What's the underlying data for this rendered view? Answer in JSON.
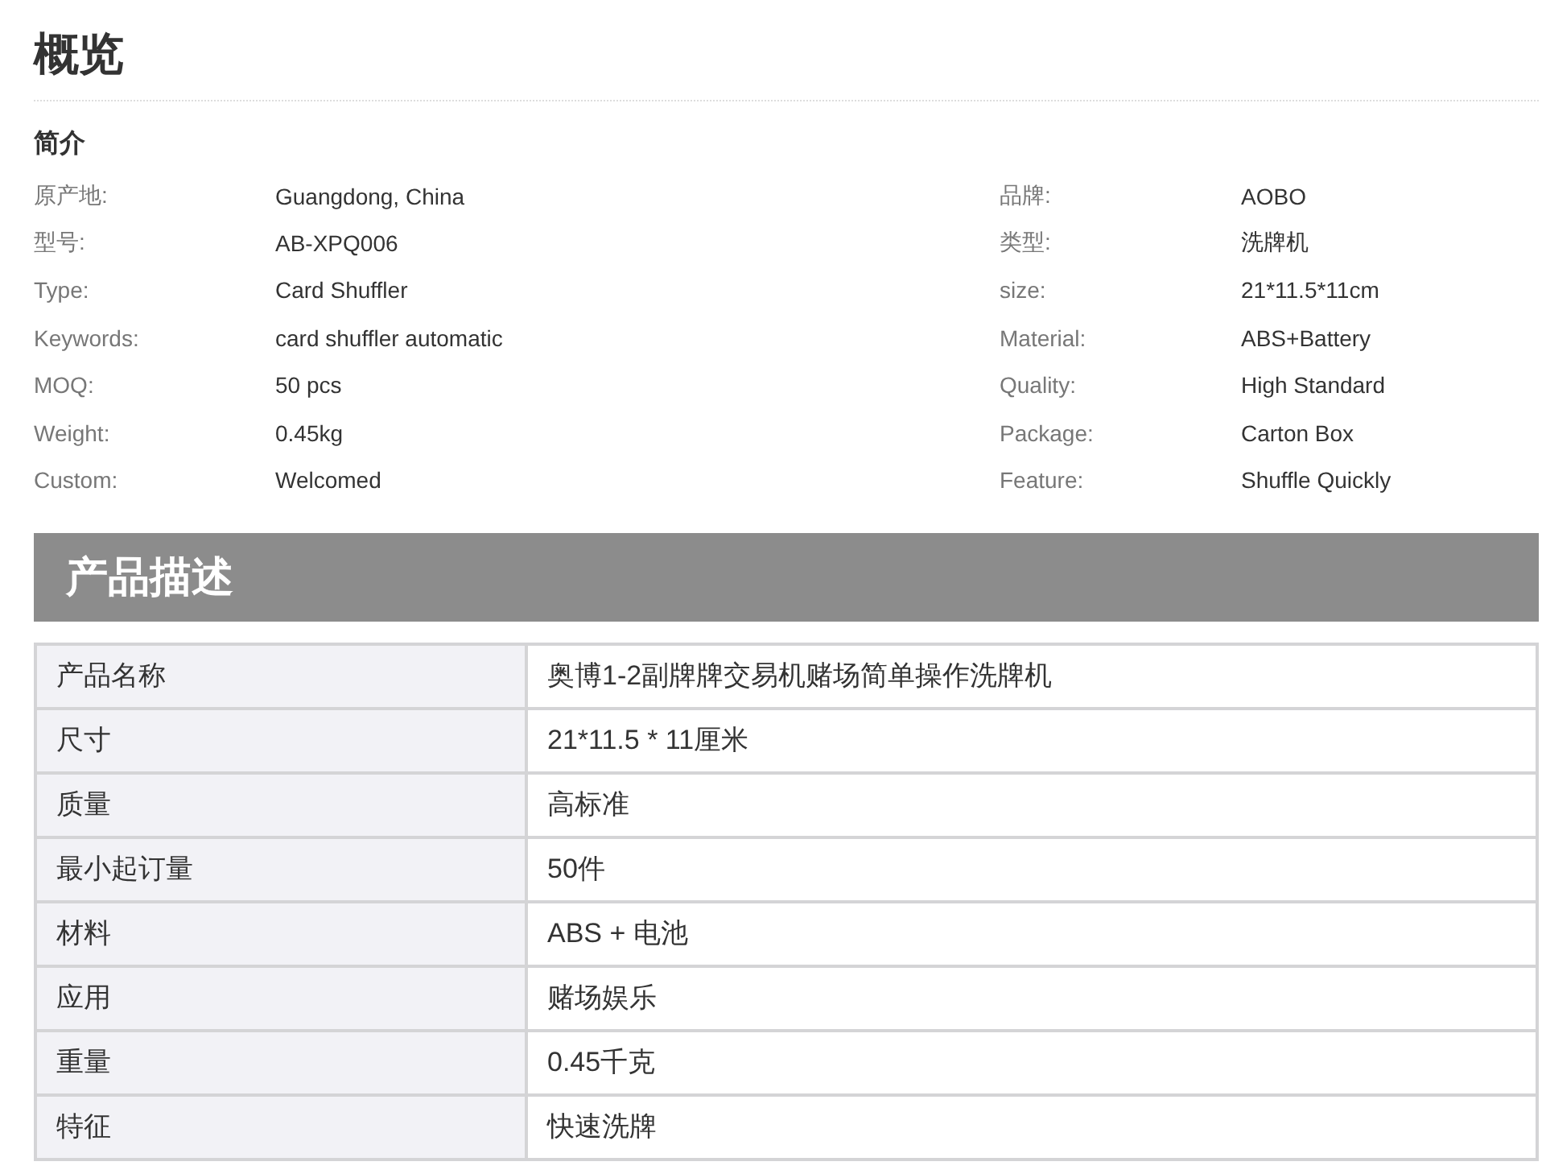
{
  "title": "概览",
  "summary": {
    "heading": "简介",
    "specs": [
      {
        "label": "原产地:",
        "value": "Guangdong, China"
      },
      {
        "label": "品牌:",
        "value": "AOBO"
      },
      {
        "label": "型号:",
        "value": "AB-XPQ006"
      },
      {
        "label": "类型:",
        "value": "洗牌机"
      },
      {
        "label": "Type:",
        "value": "Card Shuffler"
      },
      {
        "label": "size:",
        "value": "21*11.5*11cm"
      },
      {
        "label": "Keywords:",
        "value": "card shuffler automatic"
      },
      {
        "label": "Material:",
        "value": "ABS+Battery"
      },
      {
        "label": "MOQ:",
        "value": "50 pcs"
      },
      {
        "label": "Quality:",
        "value": "High Standard"
      },
      {
        "label": "Weight:",
        "value": "0.45kg"
      },
      {
        "label": "Package:",
        "value": "Carton Box"
      },
      {
        "label": "Custom:",
        "value": "Welcomed"
      },
      {
        "label": "Feature:",
        "value": "Shuffle Quickly"
      }
    ]
  },
  "description": {
    "heading": "产品描述",
    "rows": [
      {
        "name": "产品名称",
        "value": "奥博1-2副牌牌交易机赌场简单操作洗牌机"
      },
      {
        "name": "尺寸",
        "value": "21*11.5 * 11厘米"
      },
      {
        "name": "质量",
        "value": "高标准"
      },
      {
        "name": "最小起订量",
        "value": "50件"
      },
      {
        "name": "材料",
        "value": "ABS + 电池"
      },
      {
        "name": "应用",
        "value": "赌场娱乐"
      },
      {
        "name": "重量",
        "value": "0.45千克"
      },
      {
        "name": "特征",
        "value": "快速洗牌"
      }
    ]
  }
}
